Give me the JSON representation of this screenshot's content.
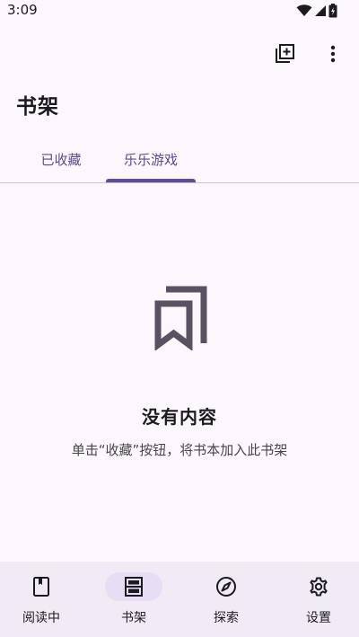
{
  "status_bar": {
    "time": "3:09",
    "icons": [
      "wifi-icon",
      "signal-icon",
      "battery-icon"
    ]
  },
  "toolbar": {
    "actions": [
      "add-to-shelf-icon",
      "more-vert-icon"
    ]
  },
  "header": {
    "title": "书架"
  },
  "tabs": [
    {
      "label": "已收藏",
      "selected": false
    },
    {
      "label": "乐乐游戏",
      "selected": true
    }
  ],
  "empty_state": {
    "icon": "bookmarks-icon",
    "title": "没有内容",
    "description": "单击“收藏”按钮，将书本加入此书架"
  },
  "bottom_nav": {
    "items": [
      {
        "label": "阅读中",
        "icon": "book-icon",
        "selected": false
      },
      {
        "label": "书架",
        "icon": "shelf-icon",
        "selected": true
      },
      {
        "label": "探索",
        "icon": "compass-icon",
        "selected": false
      },
      {
        "label": "设置",
        "icon": "gear-icon",
        "selected": false
      }
    ]
  },
  "colors": {
    "background": "#fcf7fd",
    "accent": "#5e4c9a",
    "nav_background": "#f1ebf5",
    "nav_active_pill": "#e7def5"
  }
}
